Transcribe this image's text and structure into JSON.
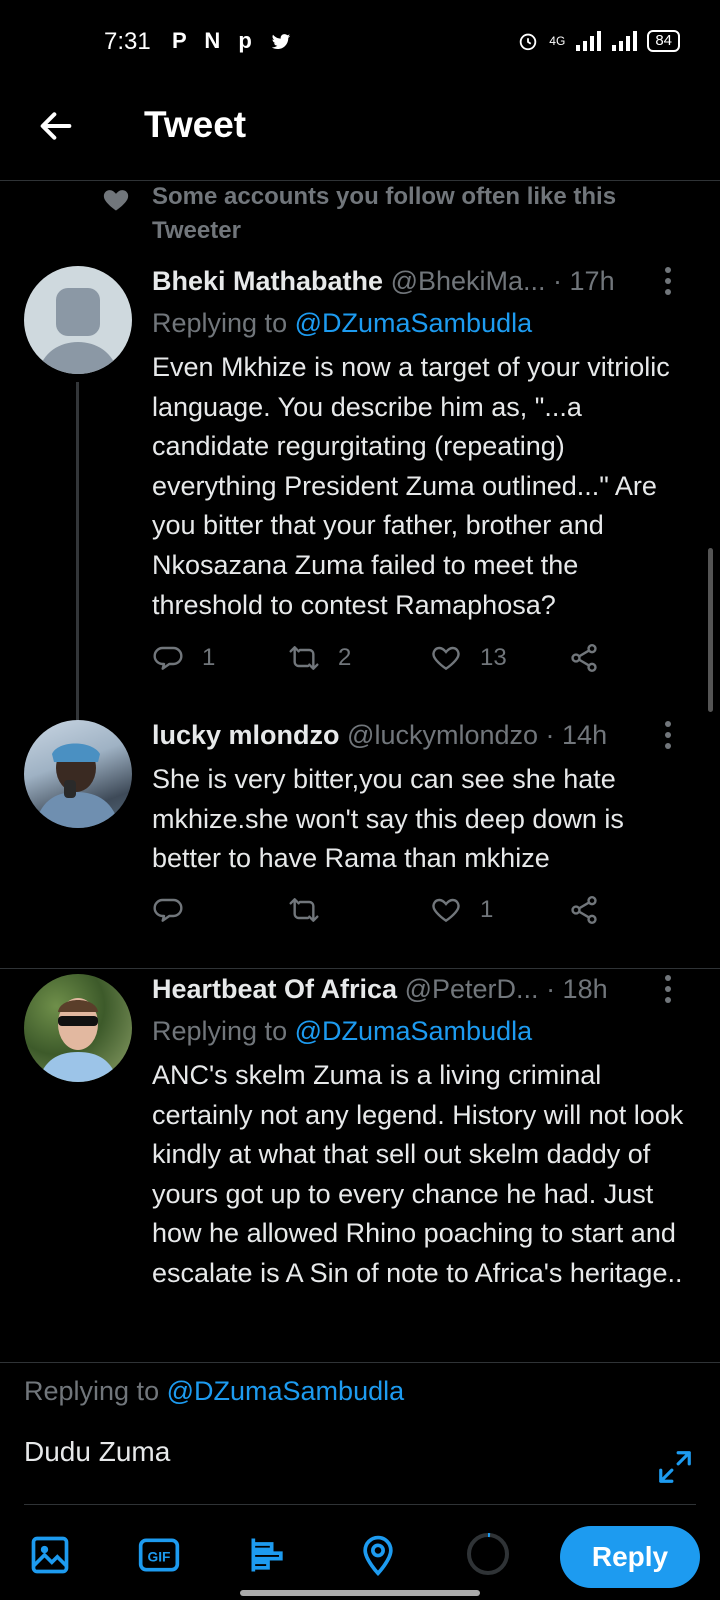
{
  "status_bar": {
    "time": "7:31",
    "app_icons": "P N p",
    "network": "4G",
    "battery": "84"
  },
  "header": {
    "title": "Tweet"
  },
  "social_context": {
    "text": "Some accounts you follow often like this Tweeter"
  },
  "tweets": [
    {
      "name": "Bheki Mathabathe",
      "handle": "@BhekiMa...",
      "time": "· 17h",
      "replying_label": "Replying to",
      "replying_to": "@DZumaSambudla",
      "text": "Even Mkhize is now a target of your vitriolic language. You describe him as, \"...a candidate regurgitating (repeating) everything President Zuma outlined...\" Are you bitter that your father, brother and Nkosazana Zuma failed to meet the threshold to contest Ramaphosa?",
      "replies": "1",
      "retweets": "2",
      "likes": "13"
    },
    {
      "name": "lucky mlondzo",
      "handle": "@luckymlondzo",
      "time": "· 14h",
      "text": "She is very bitter,you can see she hate mkhize.she won't say this deep down is better to have Rama than mkhize",
      "replies": "",
      "retweets": "",
      "likes": "1"
    },
    {
      "name": "Heartbeat Of Africa",
      "handle": "@PeterD...",
      "time": "· 18h",
      "replying_label": "Replying to",
      "replying_to": "@DZumaSambudla",
      "text": "ANC's skelm Zuma is a living criminal certainly not any legend. History will not look kindly at what that sell out skelm daddy of yours got up to every chance he had. Just how he allowed Rhino poaching to start and escalate is A Sin of note to Africa's heritage.."
    }
  ],
  "compose": {
    "replying_label": "Replying to",
    "replying_to": "@DZumaSambudla",
    "text": "Dudu Zuma",
    "reply_button": "Reply"
  },
  "colors": {
    "accent": "#1d9bf0",
    "secondary_text": "#71767b",
    "background": "#000000"
  }
}
